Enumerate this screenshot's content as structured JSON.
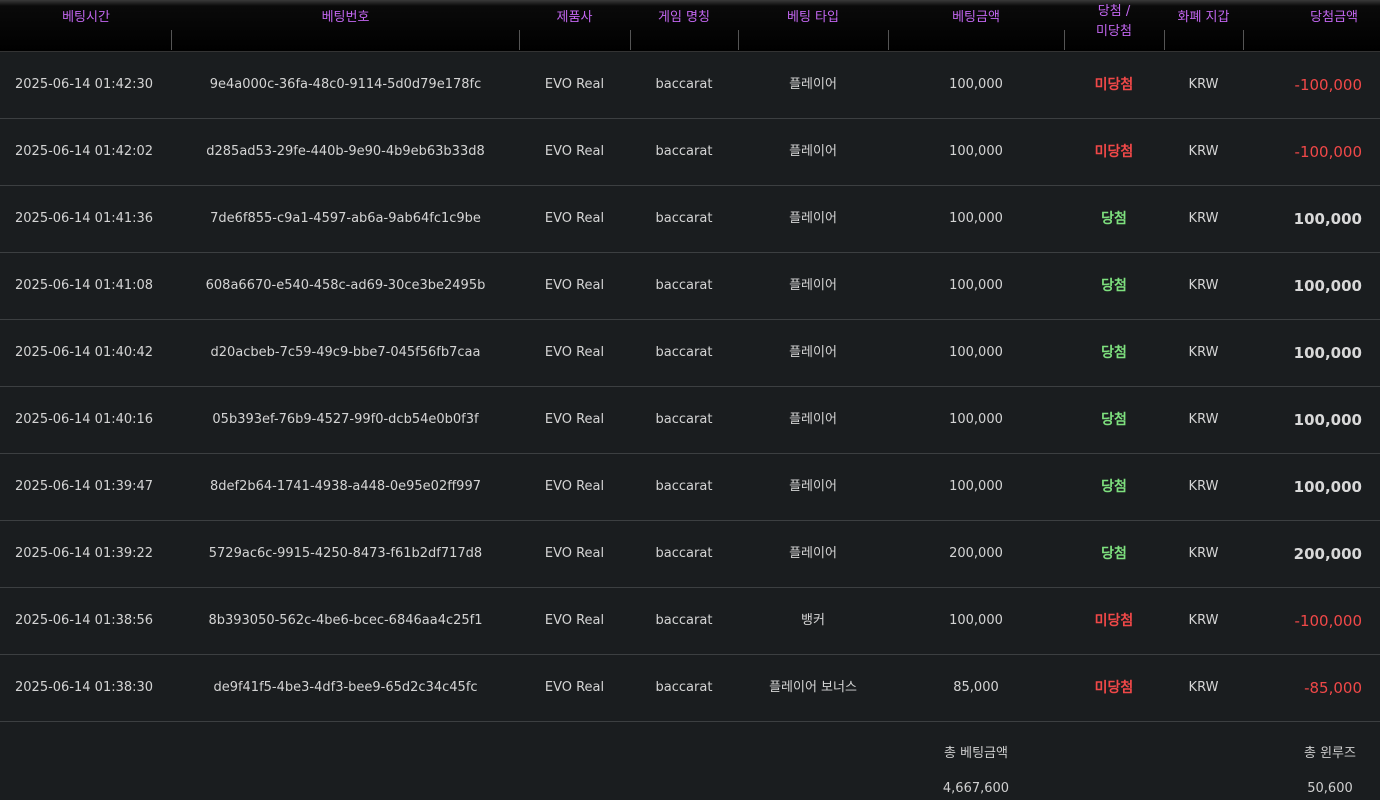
{
  "columns": [
    "베팅시간",
    "베팅번호",
    "제품사",
    "게임 명칭",
    "베팅 타입",
    "베팅금액",
    "당첨 / 미당첨",
    "화폐 지갑",
    "당첨금액"
  ],
  "rows": [
    {
      "time": "2025-06-14 01:42:30",
      "id": "9e4a000c-36fa-48c0-9114-5d0d79e178fc",
      "provider": "EVO Real",
      "game": "baccarat",
      "bet_type": "플레이어",
      "bet_amount": "100,000",
      "result": "미당첨",
      "currency": "KRW",
      "win_amount": "-100,000"
    },
    {
      "time": "2025-06-14 01:42:02",
      "id": "d285ad53-29fe-440b-9e90-4b9eb63b33d8",
      "provider": "EVO Real",
      "game": "baccarat",
      "bet_type": "플레이어",
      "bet_amount": "100,000",
      "result": "미당첨",
      "currency": "KRW",
      "win_amount": "-100,000"
    },
    {
      "time": "2025-06-14 01:41:36",
      "id": "7de6f855-c9a1-4597-ab6a-9ab64fc1c9be",
      "provider": "EVO Real",
      "game": "baccarat",
      "bet_type": "플레이어",
      "bet_amount": "100,000",
      "result": "당첨",
      "currency": "KRW",
      "win_amount": "100,000"
    },
    {
      "time": "2025-06-14 01:41:08",
      "id": "608a6670-e540-458c-ad69-30ce3be2495b",
      "provider": "EVO Real",
      "game": "baccarat",
      "bet_type": "플레이어",
      "bet_amount": "100,000",
      "result": "당첨",
      "currency": "KRW",
      "win_amount": "100,000"
    },
    {
      "time": "2025-06-14 01:40:42",
      "id": "d20acbeb-7c59-49c9-bbe7-045f56fb7caa",
      "provider": "EVO Real",
      "game": "baccarat",
      "bet_type": "플레이어",
      "bet_amount": "100,000",
      "result": "당첨",
      "currency": "KRW",
      "win_amount": "100,000"
    },
    {
      "time": "2025-06-14 01:40:16",
      "id": "05b393ef-76b9-4527-99f0-dcb54e0b0f3f",
      "provider": "EVO Real",
      "game": "baccarat",
      "bet_type": "플레이어",
      "bet_amount": "100,000",
      "result": "당첨",
      "currency": "KRW",
      "win_amount": "100,000"
    },
    {
      "time": "2025-06-14 01:39:47",
      "id": "8def2b64-1741-4938-a448-0e95e02ff997",
      "provider": "EVO Real",
      "game": "baccarat",
      "bet_type": "플레이어",
      "bet_amount": "100,000",
      "result": "당첨",
      "currency": "KRW",
      "win_amount": "100,000"
    },
    {
      "time": "2025-06-14 01:39:22",
      "id": "5729ac6c-9915-4250-8473-f61b2df717d8",
      "provider": "EVO Real",
      "game": "baccarat",
      "bet_type": "플레이어",
      "bet_amount": "200,000",
      "result": "당첨",
      "currency": "KRW",
      "win_amount": "200,000"
    },
    {
      "time": "2025-06-14 01:38:56",
      "id": "8b393050-562c-4be6-bcec-6846aa4c25f1",
      "provider": "EVO Real",
      "game": "baccarat",
      "bet_type": "뱅커",
      "bet_amount": "100,000",
      "result": "미당첨",
      "currency": "KRW",
      "win_amount": "-100,000"
    },
    {
      "time": "2025-06-14 01:38:30",
      "id": "de9f41f5-4be3-4df3-bee9-65d2c34c45fc",
      "provider": "EVO Real",
      "game": "baccarat",
      "bet_type": "플레이어 보너스",
      "bet_amount": "85,000",
      "result": "미당첨",
      "currency": "KRW",
      "win_amount": "-85,000"
    }
  ],
  "summary": {
    "total_bet_label": "총 베팅금액",
    "total_bet_value": "4,667,600",
    "total_winloss_label": "총 윈루즈",
    "total_winloss_value": "50,600"
  },
  "colors": {
    "header_text": "#c266f0",
    "win": "#7ee07e",
    "lose": "#f04848"
  }
}
